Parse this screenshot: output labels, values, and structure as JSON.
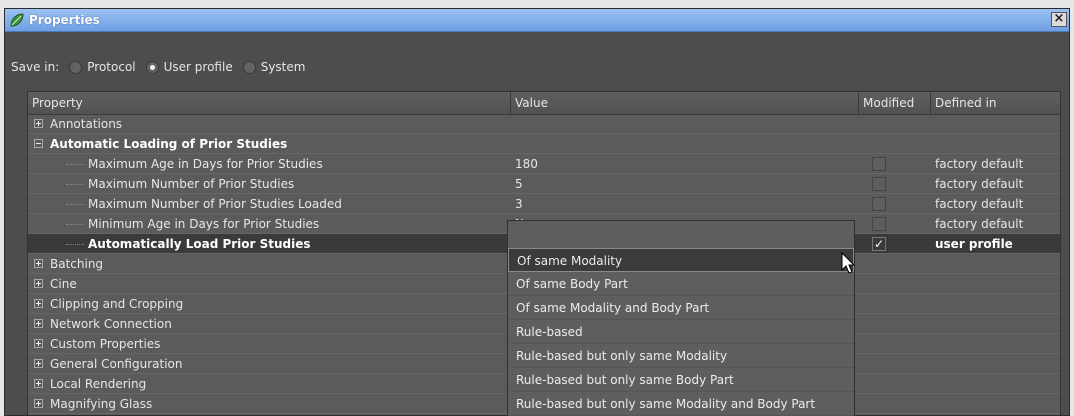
{
  "window": {
    "title": "Properties",
    "close_glyph": "×"
  },
  "save_in": {
    "label": "Save in:",
    "options": [
      "Protocol",
      "User profile",
      "System"
    ],
    "selected": "User profile"
  },
  "columns": {
    "property": "Property",
    "value": "Value",
    "modified": "Modified",
    "defined_in": "Defined in"
  },
  "rows": [
    {
      "type": "group",
      "expanded": false,
      "label": "Annotations"
    },
    {
      "type": "group",
      "expanded": true,
      "bold": true,
      "label": "Automatic Loading of Prior Studies"
    },
    {
      "type": "child",
      "label": "Maximum Age in Days for Prior Studies",
      "value": "180",
      "modified": false,
      "defined_in": "factory default"
    },
    {
      "type": "child",
      "label": "Maximum Number of Prior Studies",
      "value": "5",
      "modified": false,
      "defined_in": "factory default"
    },
    {
      "type": "child",
      "label": "Maximum Number of Prior Studies Loaded",
      "value": "3",
      "modified": false,
      "defined_in": "factory default"
    },
    {
      "type": "child",
      "label": "Minimum Age in Days for Prior Studies",
      "value": "No",
      "modified": false,
      "defined_in": "factory default"
    },
    {
      "type": "child",
      "selected": true,
      "label": "Automatically Load Prior Studies",
      "value": "",
      "modified": true,
      "defined_in": "user profile"
    },
    {
      "type": "group",
      "expanded": false,
      "label": "Batching"
    },
    {
      "type": "group",
      "expanded": false,
      "label": "Cine"
    },
    {
      "type": "group",
      "expanded": false,
      "label": "Clipping and Cropping"
    },
    {
      "type": "group",
      "expanded": false,
      "label": "Network Connection"
    },
    {
      "type": "group",
      "expanded": false,
      "label": "Custom Properties"
    },
    {
      "type": "group",
      "expanded": false,
      "label": "General Configuration"
    },
    {
      "type": "group",
      "expanded": false,
      "label": "Local Rendering"
    },
    {
      "type": "group",
      "expanded": false,
      "label": "Magnifying Glass"
    }
  ],
  "dropdown": {
    "highlighted": "Of same Modality",
    "options": [
      "Of same Modality",
      "Of same Body Part",
      "Of same Modality and Body Part",
      "Rule-based",
      "Rule-based but only same Modality",
      "Rule-based but only same Body Part",
      "Rule-based but only same Modality and Body Part"
    ]
  },
  "colors": {
    "background": "#4d4d4d",
    "selected_row": "#3a3a3a",
    "titlebar": "#7eaaea"
  },
  "icons": {
    "app": "app-leaf-icon",
    "pointer": "mouse-pointer-icon"
  }
}
